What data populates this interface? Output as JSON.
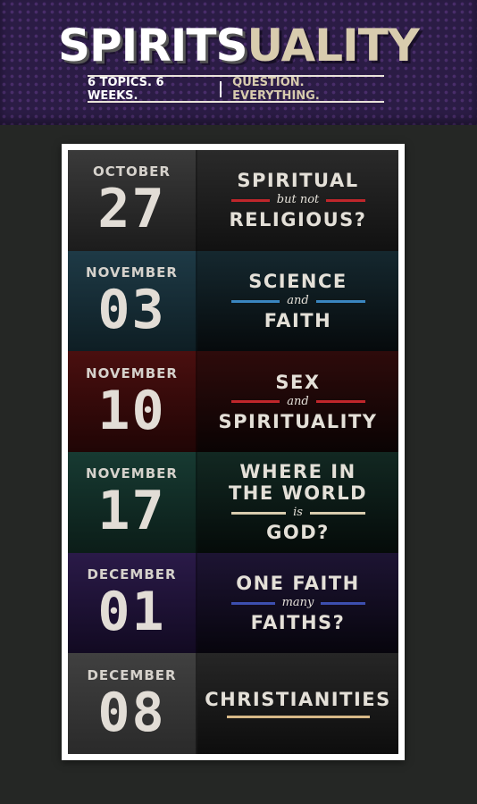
{
  "header": {
    "logo_part1": "SPIRITS",
    "logo_part2": "UALITY",
    "tagline_left": "6 TOPICS. 6 WEEKS.",
    "tagline_right": "QUESTION. EVERYTHING.",
    "colors": {
      "background": "#2b1c45",
      "accent": "#d8ccae"
    }
  },
  "sessions": [
    {
      "month": "OCTOBER",
      "day": "27",
      "line1": "SPIRITUAL",
      "connector": "but not",
      "line2": "RELIGIOUS?",
      "accent": "#c0262b"
    },
    {
      "month": "NOVEMBER",
      "day": "03",
      "line1": "SCIENCE",
      "connector": "and",
      "line2": "FAITH",
      "accent": "#3a86c0"
    },
    {
      "month": "NOVEMBER",
      "day": "10",
      "line1": "SEX",
      "connector": "and",
      "line2": "SPIRITUALITY",
      "accent": "#c0262b"
    },
    {
      "month": "NOVEMBER",
      "day": "17",
      "line1": "WHERE IN",
      "line1b": "THE WORLD",
      "connector": "is",
      "line2": "GOD?",
      "accent": "#d8ccae"
    },
    {
      "month": "DECEMBER",
      "day": "01",
      "line1": "ONE FAITH",
      "connector": "many",
      "line2": "FAITHS?",
      "accent": "#3d4fb0"
    },
    {
      "month": "DECEMBER",
      "day": "08",
      "line1": "CHRISTIANITIES",
      "accent": "#d8b988"
    }
  ]
}
